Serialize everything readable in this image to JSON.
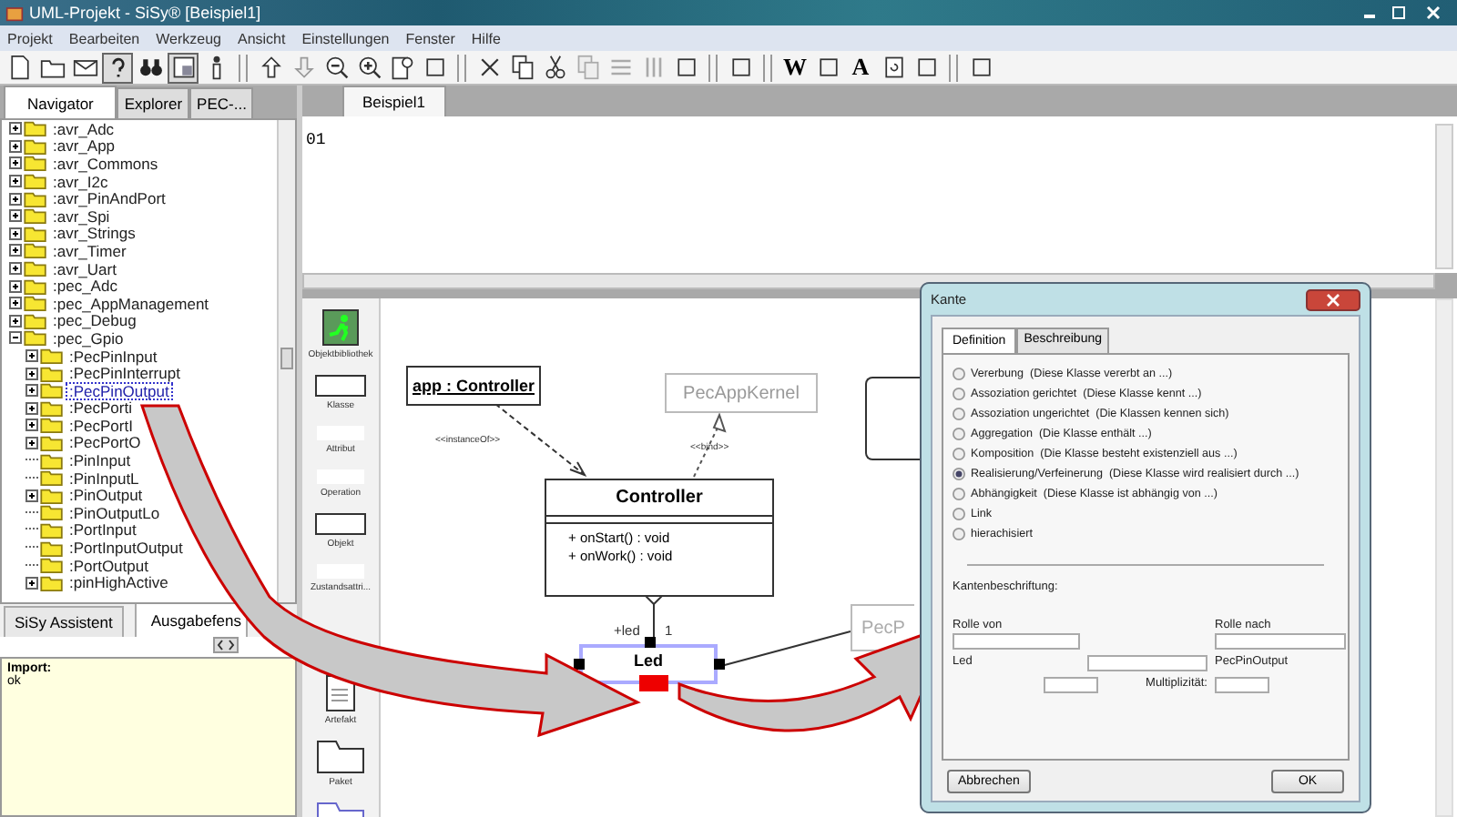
{
  "window": {
    "title": "UML-Projekt - SiSy® [Beispiel1]"
  },
  "menu": [
    "Projekt",
    "Bearbeiten",
    "Werkzeug",
    "Ansicht",
    "Einstellungen",
    "Fenster",
    "Hilfe"
  ],
  "toolbar": [
    {
      "kind": "button",
      "pressed": false
    },
    {
      "kind": "button",
      "pressed": false
    },
    {
      "kind": "button",
      "pressed": false
    },
    {
      "kind": "button",
      "pressed": true
    },
    {
      "kind": "button",
      "pressed": false
    },
    {
      "kind": "button",
      "pressed": true
    },
    {
      "kind": "button",
      "pressed": false
    },
    {
      "kind": "separator"
    },
    {
      "kind": "button",
      "pressed": false
    },
    {
      "kind": "button",
      "pressed": false
    },
    {
      "kind": "button",
      "pressed": false
    },
    {
      "kind": "button",
      "pressed": false
    },
    {
      "kind": "button",
      "pressed": false
    },
    {
      "kind": "button",
      "pressed": false
    },
    {
      "kind": "separator"
    },
    {
      "kind": "button",
      "pressed": false
    },
    {
      "kind": "button",
      "pressed": false
    },
    {
      "kind": "button",
      "pressed": false
    },
    {
      "kind": "button",
      "pressed": false
    },
    {
      "kind": "button",
      "pressed": false
    },
    {
      "kind": "button",
      "pressed": false
    },
    {
      "kind": "button",
      "pressed": false
    },
    {
      "kind": "separator"
    },
    {
      "kind": "button",
      "pressed": false
    },
    {
      "kind": "separator"
    },
    {
      "kind": "glyph",
      "text": "W",
      "pressed": false
    },
    {
      "kind": "button",
      "pressed": false
    },
    {
      "kind": "glyph",
      "text": "A",
      "pressed": false
    },
    {
      "kind": "button",
      "pressed": false
    },
    {
      "kind": "button",
      "pressed": false
    },
    {
      "kind": "separator"
    },
    {
      "kind": "button",
      "pressed": false
    }
  ],
  "nav_tabs": [
    {
      "label": "Navigator",
      "selected": true
    },
    {
      "label": "Explorer",
      "selected": false
    },
    {
      "label": "PEC-...",
      "selected": false
    }
  ],
  "tree": [
    {
      "label": ":avr_Adc",
      "expanded": false,
      "selected": false
    },
    {
      "label": ":avr_App",
      "expanded": false,
      "selected": false
    },
    {
      "label": ":avr_Commons",
      "expanded": false,
      "selected": false
    },
    {
      "label": ":avr_I2c",
      "expanded": false,
      "selected": false
    },
    {
      "label": ":avr_PinAndPort",
      "expanded": false,
      "selected": false
    },
    {
      "label": ":avr_Spi",
      "expanded": false,
      "selected": false
    },
    {
      "label": ":avr_Strings",
      "expanded": false,
      "selected": false
    },
    {
      "label": ":avr_Timer",
      "expanded": false,
      "selected": false
    },
    {
      "label": ":avr_Uart",
      "expanded": false,
      "selected": false
    },
    {
      "label": ":pec_Adc",
      "expanded": false,
      "selected": false
    },
    {
      "label": ":pec_AppManagement",
      "expanded": false,
      "selected": false
    },
    {
      "label": ":pec_Debug",
      "expanded": false,
      "selected": false
    },
    {
      "label": ":pec_Gpio",
      "expanded": true,
      "selected": false,
      "children": [
        {
          "label": ":PecPinInput",
          "expanded": false,
          "selected": false
        },
        {
          "label": ":PecPinInterrupt",
          "expanded": false,
          "selected": false
        },
        {
          "label": ":PecPinOutput",
          "expanded": false,
          "selected": true
        },
        {
          "label": ":PecPorti",
          "expanded": false,
          "selected": false
        },
        {
          "label": ":PecPortI",
          "expanded": false,
          "selected": false
        },
        {
          "label": ":PecPortO",
          "expanded": false,
          "selected": false
        },
        {
          "label": ":PinInput",
          "selected": false
        },
        {
          "label": ":PinInputL",
          "selected": false
        },
        {
          "label": ":PinOutput",
          "expanded": false,
          "selected": false
        },
        {
          "label": ":PinOutputLo",
          "selected": false
        },
        {
          "label": ":PortInput",
          "selected": false
        },
        {
          "label": ":PortInputOutput",
          "selected": false
        },
        {
          "label": ":PortOutput",
          "selected": false
        },
        {
          "label": ":pinHighActive",
          "expanded": false,
          "selected": false
        }
      ]
    }
  ],
  "bottom_tabs": [
    {
      "label": "SiSy Assistent",
      "selected": false
    },
    {
      "label": "Ausgabefens",
      "selected": true
    }
  ],
  "output": {
    "heading": "Import:",
    "text": "ok"
  },
  "editor": {
    "tab": "Beispiel1",
    "line": "01"
  },
  "palette": [
    {
      "kind": "library",
      "label": "Objektbibliothek"
    },
    {
      "kind": "class",
      "label": "Klasse"
    },
    {
      "kind": "blank",
      "label": "Attribut"
    },
    {
      "kind": "blank",
      "label": "Operation"
    },
    {
      "kind": "class",
      "label": "Objekt"
    },
    {
      "kind": "blank",
      "label": "Zustandsattri..."
    },
    {
      "kind": "doc",
      "label": "Artefakt"
    },
    {
      "kind": "folder",
      "label": "Paket"
    },
    {
      "kind": "folder2"
    }
  ],
  "diagram": {
    "instance": "app : Controller",
    "instance_link": "<<instanceOf>>",
    "template": "PecAppKernel",
    "bind_link": "<<bind>>",
    "class_name": "Controller",
    "operations": [
      "+ onStart() : void",
      "+ onWork() : void"
    ],
    "role": "+led",
    "multiplicity": "1",
    "selected_class": "Led",
    "other_class": "PecP"
  },
  "dialog": {
    "title": "Kante",
    "tabs": [
      {
        "label": "Definition",
        "selected": true
      },
      {
        "label": "Beschreibung",
        "selected": false
      }
    ],
    "options": [
      {
        "label": "Vererbung  (Diese Klasse vererbt an ...)",
        "selected": false
      },
      {
        "label": "Assoziation gerichtet  (Diese Klasse kennt ...)",
        "selected": false
      },
      {
        "label": "Assoziation ungerichtet  (Die Klassen kennen sich)",
        "selected": false
      },
      {
        "label": "Aggregation  (Die Klasse enthält ...)",
        "selected": false
      },
      {
        "label": "Komposition  (Die Klasse besteht existenziell aus ...)",
        "selected": false
      },
      {
        "label": "Realisierung/Verfeinerung  (Diese Klasse wird realisiert durch ...)",
        "selected": true
      },
      {
        "label": "Abhängigkeit  (Diese Klasse ist abhängig von ...)",
        "selected": false
      },
      {
        "label": "Link",
        "selected": false
      },
      {
        "label": "hierachisiert",
        "selected": false
      }
    ],
    "section": "Kantenbeschriftung:",
    "role_from": "Rolle von",
    "role_to": "Rolle nach",
    "from_class": "Led",
    "to_class": "PecPinOutput",
    "multiplicity_label": "Multiplizität:",
    "buttons": [
      "Abbrechen",
      "OK"
    ]
  }
}
